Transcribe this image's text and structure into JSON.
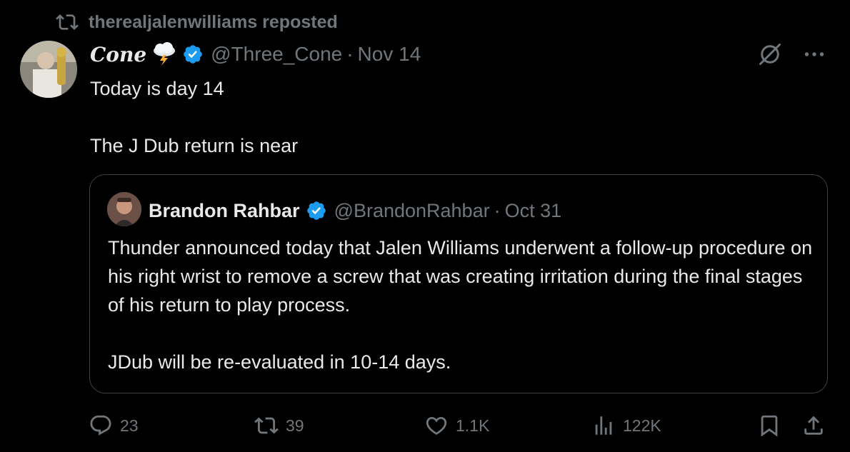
{
  "repost": {
    "text": "therealjalenwilliams reposted"
  },
  "post": {
    "author_name": "Cone",
    "author_handle": "@Three_Cone",
    "date": "Nov 14",
    "text_line1": "Today is day 14",
    "text_line2": "The J Dub return is near"
  },
  "quoted": {
    "author_name": "Brandon Rahbar",
    "author_handle": "@BrandonRahbar",
    "date": "Oct 31",
    "text_para1": "Thunder announced today that Jalen Williams underwent a follow-up procedure on his right wrist to remove a screw that was creating irritation during the final stages of his return to play process.",
    "text_para2": "JDub will be re-evaluated in 10-14 days."
  },
  "actions": {
    "replies": "23",
    "reposts": "39",
    "likes": "1.1K",
    "views": "122K"
  },
  "icons": [
    "repost-icon",
    "storm-emoji-icon",
    "verified-badge-icon",
    "grok-icon",
    "more-icon",
    "reply-icon",
    "like-icon",
    "views-icon",
    "bookmark-icon",
    "share-icon"
  ],
  "colors": {
    "background": "#000000",
    "text": "#e7e9ea",
    "muted": "#71767b",
    "verified": "#1d9bf0",
    "border": "#3e4144"
  }
}
